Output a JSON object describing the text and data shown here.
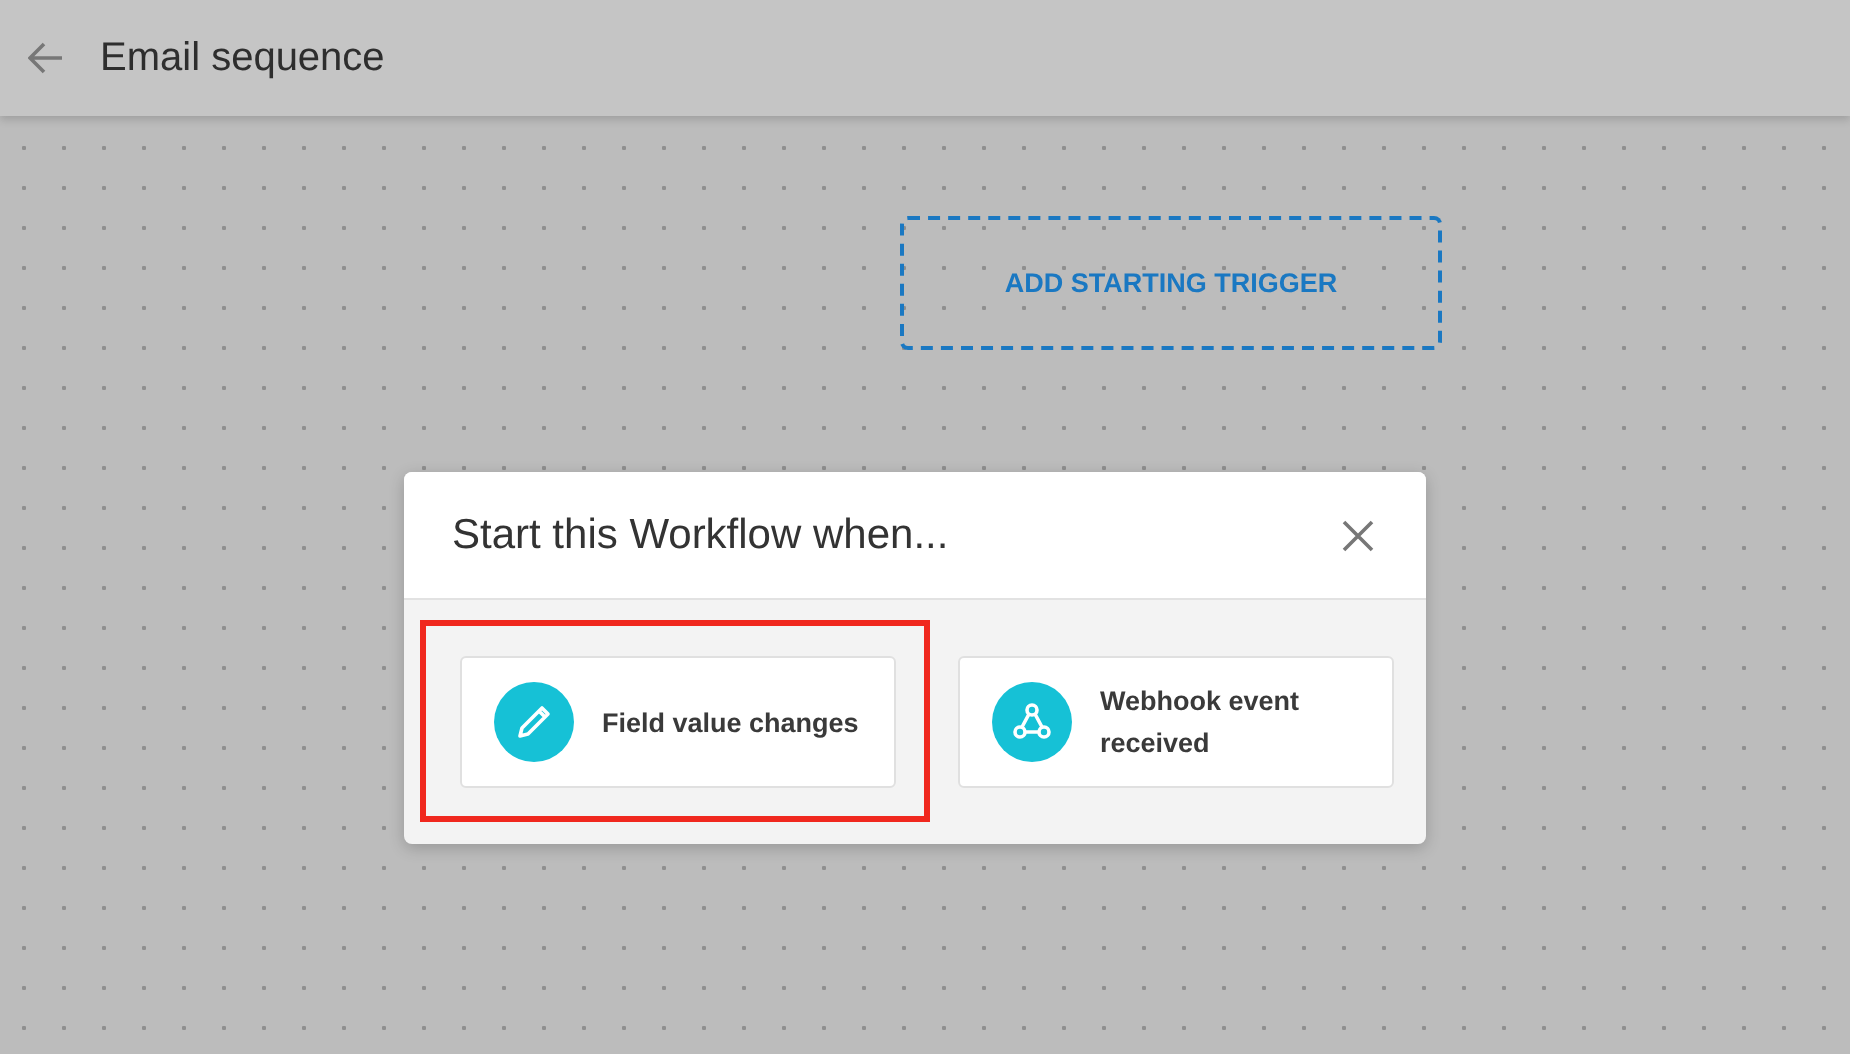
{
  "header": {
    "title": "Email sequence"
  },
  "canvas": {
    "trigger_button": "ADD STARTING TRIGGER"
  },
  "dialog": {
    "title": "Start this Workflow when...",
    "options": [
      {
        "kind": "pencil",
        "label": "Field value changes",
        "highlighted": true
      },
      {
        "kind": "webhook",
        "label": "Webhook event received",
        "highlighted": false
      }
    ]
  }
}
